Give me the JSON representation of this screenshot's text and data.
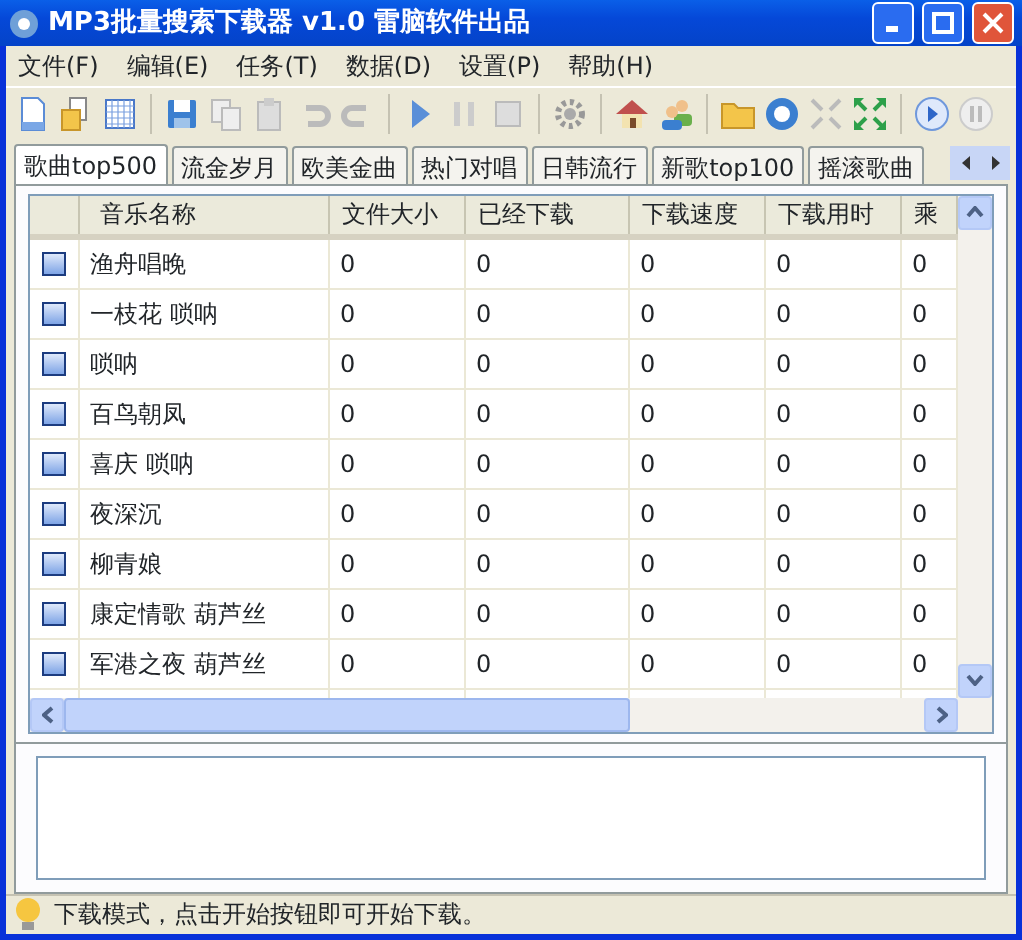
{
  "window": {
    "title": "MP3批量搜索下载器 v1.0 雷脑软件出品"
  },
  "menu": [
    "文件(F)",
    "编辑(E)",
    "任务(T)",
    "数据(D)",
    "设置(P)",
    "帮助(H)"
  ],
  "tabs": [
    {
      "label": "歌曲top500",
      "selected": true
    },
    {
      "label": "流金岁月",
      "selected": false
    },
    {
      "label": "欧美金曲",
      "selected": false
    },
    {
      "label": "热门对唱",
      "selected": false
    },
    {
      "label": "日韩流行",
      "selected": false
    },
    {
      "label": "新歌top100",
      "selected": false
    },
    {
      "label": "摇滚歌曲",
      "selected": false
    }
  ],
  "table": {
    "columns": [
      "音乐名称",
      "文件大小",
      "已经下载",
      "下载速度",
      "下载用时",
      "乘"
    ],
    "rows": [
      {
        "checked": false,
        "cells": [
          "渔舟唱晚",
          "0",
          "0",
          "0",
          "0",
          "0"
        ]
      },
      {
        "checked": false,
        "cells": [
          "一枝花 唢呐",
          "0",
          "0",
          "0",
          "0",
          "0"
        ]
      },
      {
        "checked": false,
        "cells": [
          "唢呐",
          "0",
          "0",
          "0",
          "0",
          "0"
        ]
      },
      {
        "checked": false,
        "cells": [
          "百鸟朝凤",
          "0",
          "0",
          "0",
          "0",
          "0"
        ]
      },
      {
        "checked": false,
        "cells": [
          "喜庆 唢呐",
          "0",
          "0",
          "0",
          "0",
          "0"
        ]
      },
      {
        "checked": false,
        "cells": [
          "夜深沉",
          "0",
          "0",
          "0",
          "0",
          "0"
        ]
      },
      {
        "checked": false,
        "cells": [
          "柳青娘",
          "0",
          "0",
          "0",
          "0",
          "0"
        ]
      },
      {
        "checked": false,
        "cells": [
          "康定情歌 葫芦丝",
          "0",
          "0",
          "0",
          "0",
          "0"
        ]
      },
      {
        "checked": false,
        "cells": [
          "军港之夜 葫芦丝",
          "0",
          "0",
          "0",
          "0",
          "0"
        ]
      }
    ]
  },
  "status_bar": {
    "text": "下载模式，点击开始按钮即可开始下载。"
  }
}
